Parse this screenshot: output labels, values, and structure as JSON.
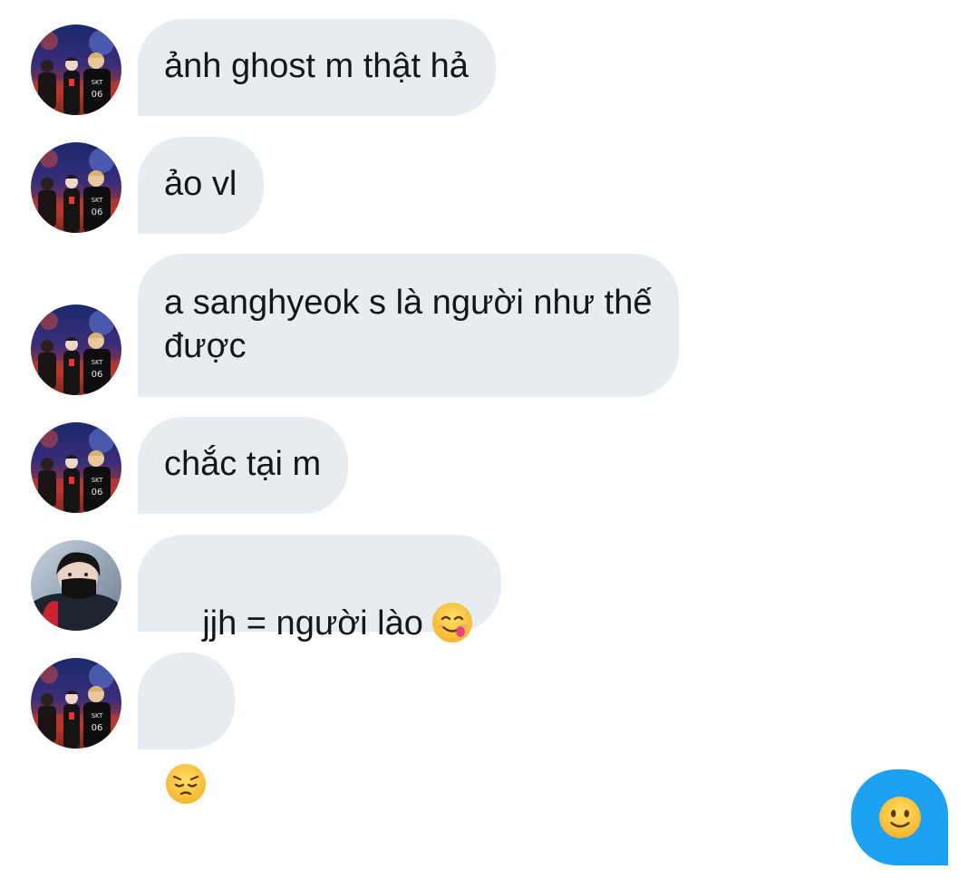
{
  "conversation": {
    "messages": [
      {
        "sender": "contact_a",
        "text": "ảnh ghost m thật hả"
      },
      {
        "sender": "contact_a",
        "text": "ảo vl"
      },
      {
        "sender": "contact_a",
        "text": "a sanghyeok s là người như thế\nđược"
      },
      {
        "sender": "contact_a",
        "text": "chắc tại m"
      },
      {
        "sender": "contact_b",
        "text": "jjh = người lào",
        "emoji": "face-savoring-food-emoji"
      },
      {
        "sender": "contact_a",
        "text": "",
        "emoji": "pensive-face-emoji"
      }
    ],
    "sent_messages": [
      {
        "sender": "me",
        "emoji": "slightly-smiling-face-emoji"
      }
    ]
  },
  "icons": {
    "avatar_a": "avatar-photo-group",
    "avatar_b": "avatar-photo-masked-person"
  },
  "colors": {
    "received_bubble": "#e6ecf0",
    "sent_bubble": "#1da1f2",
    "text": "#14171a",
    "background": "#ffffff"
  }
}
